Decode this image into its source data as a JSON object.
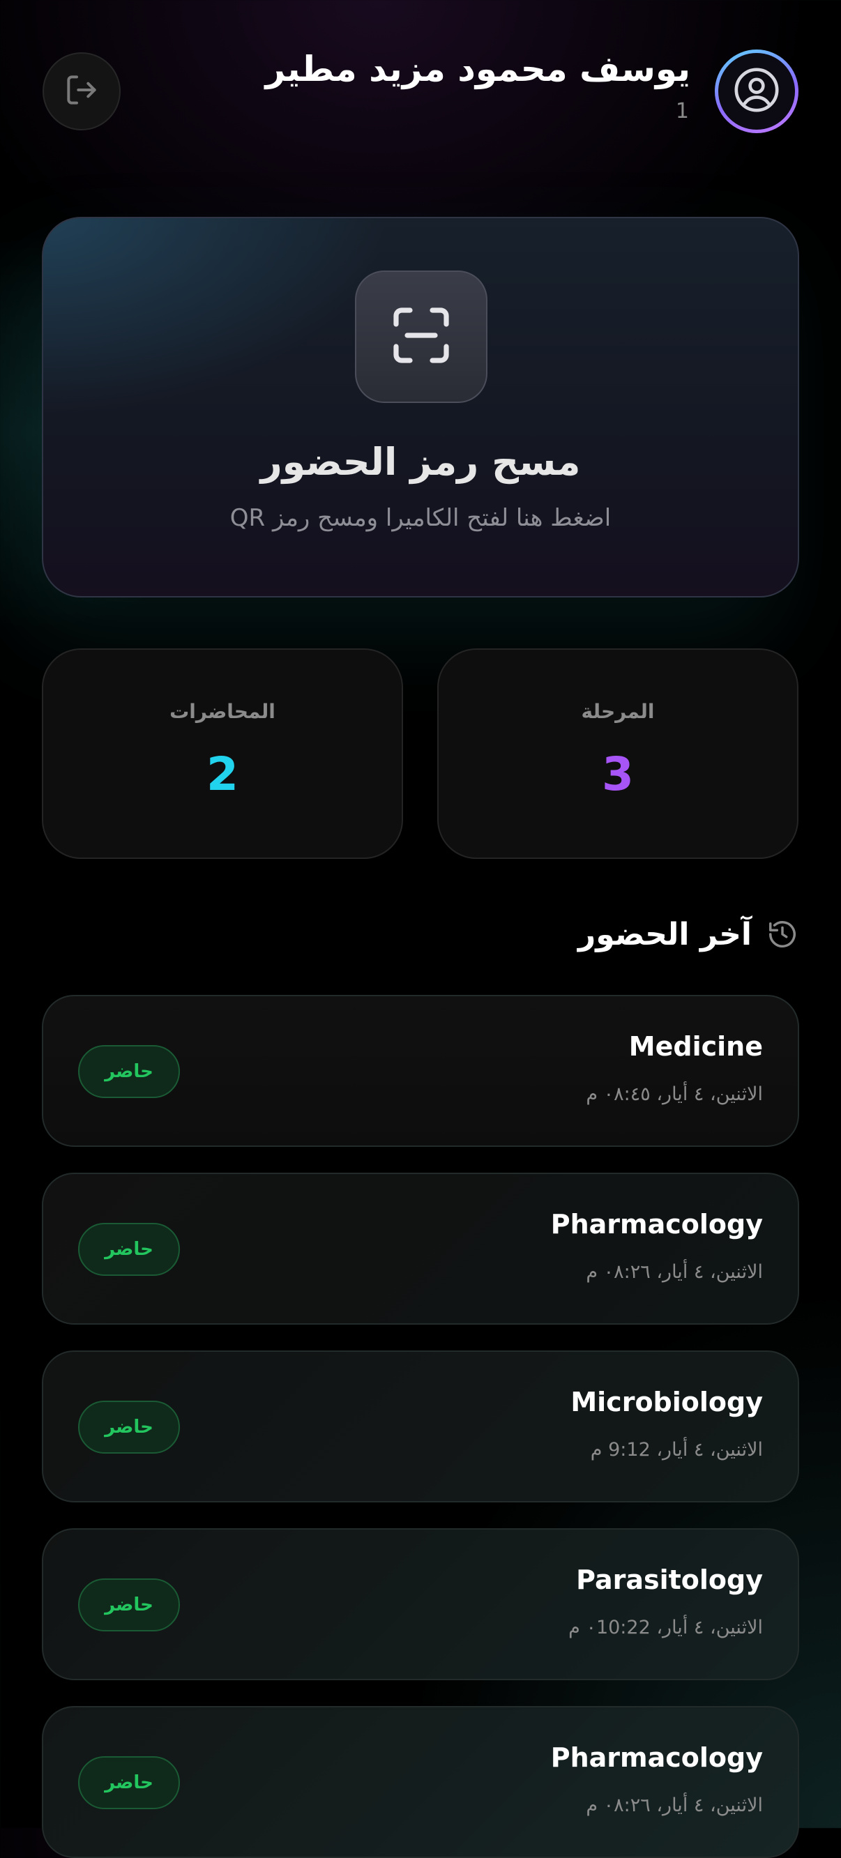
{
  "user": {
    "name": "يوسف محمود مزيد مطير",
    "id": "1"
  },
  "scan": {
    "title": "مسح رمز الحضور",
    "subtitle": "اضغط هنا لفتح الكاميرا ومسح رمز QR"
  },
  "stats": {
    "lectures": {
      "label": "المحاضرات",
      "value": "2",
      "color": "#22d3ee"
    },
    "stage": {
      "label": "المرحلة",
      "value": "3",
      "color": "#a855f7"
    }
  },
  "history": {
    "title": "آخر الحضور",
    "items": [
      {
        "subject": "Medicine",
        "time": "الاثنين، ٤ أيار، ٠٨:٤٥ م",
        "status": "حاضر"
      },
      {
        "subject": "Pharmacology",
        "time": "الاثنين، ٤ أيار، ٠٨:٢٦ م",
        "status": "حاضر"
      },
      {
        "subject": "Microbiology",
        "time": "الاثنين، ٤ أيار، 9:12 م",
        "status": "حاضر"
      },
      {
        "subject": "Parasitology",
        "time": "الاثنين، ٤ أيار، ٠10:22 م",
        "status": "حاضر"
      },
      {
        "subject": "Pharmacology",
        "time": "الاثنين، ٤ أيار، ٠٨:٢٦ م",
        "status": "حاضر"
      }
    ]
  },
  "icons": {
    "logout": "logout-icon",
    "avatar": "user-circle-icon",
    "scan": "scan-icon",
    "history": "history-icon"
  },
  "colors": {
    "present_text": "#22c55e",
    "avatar_ring_start": "#5ed4ff",
    "avatar_ring_end": "#c27bff"
  }
}
